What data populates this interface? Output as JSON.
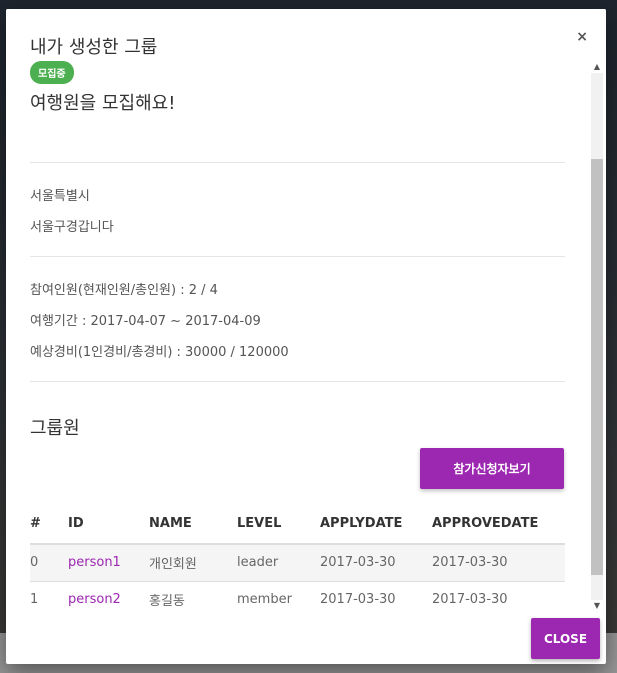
{
  "modal": {
    "title": "내가 생성한 그룹",
    "close_icon": "×",
    "badge": "모집중",
    "group_title": "여행원을 모집해요!",
    "location": "서울특별시",
    "description": "서울구경갑니다",
    "participants": "참여인원(현재인원/총인원) : 2 / 4",
    "period": "여행기간 : 2017-04-07 ~ 2017-04-09",
    "budget": "예상경비(1인경비/총경비) : 30000 / 120000",
    "members_title": "그룹원",
    "applicants_button": "참가신청자보기",
    "close_button": "CLOSE"
  },
  "table": {
    "headers": [
      "#",
      "ID",
      "NAME",
      "LEVEL",
      "APPLYDATE",
      "APPROVEDATE"
    ],
    "rows": [
      [
        "0",
        "person1",
        "개인회원",
        "leader",
        "2017-03-30",
        "2017-03-30"
      ],
      [
        "1",
        "person2",
        "홍길동",
        "member",
        "2017-03-30",
        "2017-03-30"
      ]
    ]
  },
  "colors": {
    "accent": "#9c27b0",
    "badge": "#4caf50"
  }
}
